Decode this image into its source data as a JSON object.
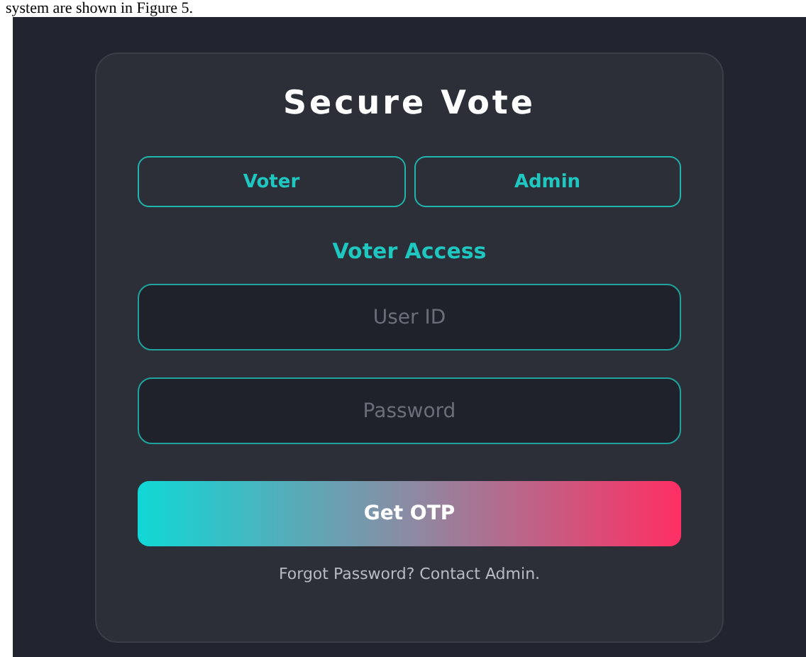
{
  "caption": "system are shown in Figure 5.",
  "card": {
    "title": "Secure Vote",
    "tabs": [
      {
        "label": "Voter"
      },
      {
        "label": "Admin"
      }
    ],
    "heading": "Voter Access",
    "fields": [
      {
        "placeholder": "User ID"
      },
      {
        "placeholder": "Password"
      }
    ],
    "button": "Get OTP",
    "footer": "Forgot Password? Contact Admin."
  }
}
